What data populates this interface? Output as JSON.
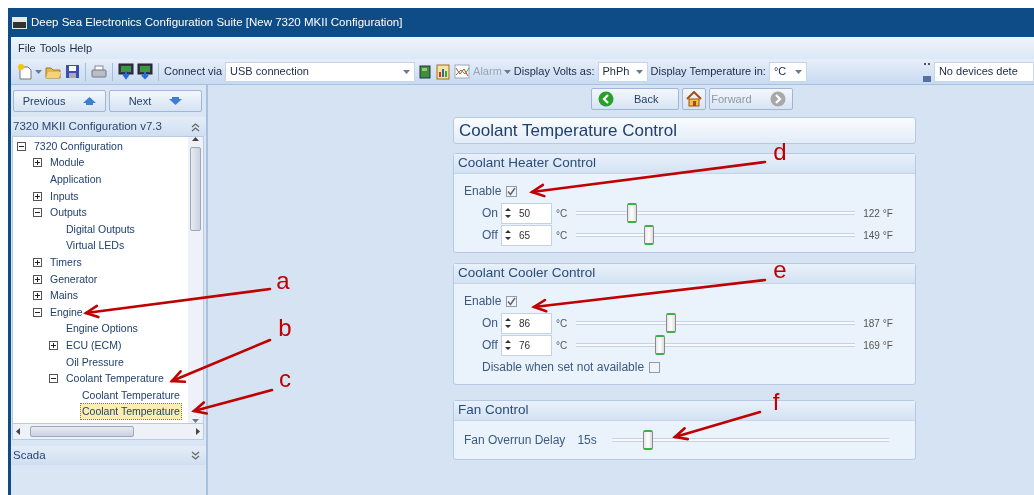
{
  "window": {
    "title": "Deep Sea Electronics Configuration Suite [New 7320 MKII Configuration]"
  },
  "menu": [
    "File",
    "Tools",
    "Help"
  ],
  "toolbar": {
    "connect_label": "Connect via",
    "connection": "USB connection",
    "alarm": {
      "label": "Alarm",
      "disabled": true
    },
    "volts_label": "Display Volts as:",
    "volts": "PhPh",
    "temperature_label": "Display Temperature in:",
    "temperature": "°C",
    "device_status": "No devices dete"
  },
  "sidebar": {
    "nav_buttons": [
      {
        "kind": "previous",
        "label": "Previous"
      },
      {
        "kind": "next",
        "label": "Next"
      }
    ],
    "header": "7320 MKII Configuration v7.3",
    "tree": [
      {
        "label": "7320 Configuration",
        "expanded": true,
        "selected": false,
        "children": [
          {
            "label": "Module",
            "expanded": false,
            "selected": false
          },
          {
            "label": "Application",
            "selected": false
          },
          {
            "label": "Inputs",
            "expanded": false,
            "selected": false
          },
          {
            "label": "Outputs",
            "expanded": true,
            "selected": false,
            "children": [
              {
                "label": "Digital Outputs",
                "selected": false
              },
              {
                "label": "Virtual LEDs",
                "selected": false
              }
            ]
          },
          {
            "label": "Timers",
            "expanded": false,
            "selected": false
          },
          {
            "label": "Generator",
            "expanded": false,
            "selected": false
          },
          {
            "label": "Mains",
            "expanded": false,
            "selected": false
          },
          {
            "label": "Engine",
            "expanded": true,
            "selected": false,
            "children": [
              {
                "label": "Engine Options",
                "selected": false
              },
              {
                "label": "ECU (ECM)",
                "expanded": false,
                "selected": false
              },
              {
                "label": "Oil Pressure",
                "selected": false
              },
              {
                "label": "Coolant Temperature",
                "expanded": true,
                "selected": false,
                "children": [
                  {
                    "label": "Coolant Temperature",
                    "selected": false
                  },
                  {
                    "label": "Coolant Temperature",
                    "selected": true
                  }
                ]
              }
            ]
          }
        ]
      }
    ],
    "bottom_header": "Scada"
  },
  "main": {
    "nav": [
      {
        "kind": "back",
        "label": "Back",
        "disabled": false
      },
      {
        "kind": "home",
        "disabled": false
      },
      {
        "kind": "forward",
        "label": "Forward",
        "disabled": true
      }
    ],
    "title": "Coolant Temperature Control",
    "groups": [
      {
        "title": "Coolant Heater Control",
        "rows": [
          {
            "kind": "checkbox",
            "label": "Enable",
            "checked": true
          },
          {
            "kind": "setpoint",
            "label": "On",
            "value": "50",
            "unit": "°C",
            "level": 0.2,
            "reading": "122 °F"
          },
          {
            "kind": "setpoint",
            "label": "Off",
            "value": "65",
            "unit": "°C",
            "level": 0.26,
            "reading": "149 °F"
          }
        ]
      },
      {
        "title": "Coolant Cooler Control",
        "rows": [
          {
            "kind": "checkbox",
            "label": "Enable",
            "checked": true
          },
          {
            "kind": "setpoint",
            "label": "On",
            "value": "86",
            "unit": "°C",
            "level": 0.34,
            "reading": "187 °F"
          },
          {
            "kind": "setpoint",
            "label": "Off",
            "value": "76",
            "unit": "°C",
            "level": 0.3,
            "reading": "169 °F"
          },
          {
            "kind": "option",
            "label": "Disable when set not available",
            "checked": false
          }
        ]
      },
      {
        "title": "Fan Control",
        "rows": [
          {
            "kind": "delay",
            "label": "Fan Overrun Delay",
            "value": "15s",
            "level": 0.13
          }
        ]
      }
    ]
  },
  "annotations": [
    "a",
    "b",
    "c",
    "d",
    "e",
    "f"
  ]
}
